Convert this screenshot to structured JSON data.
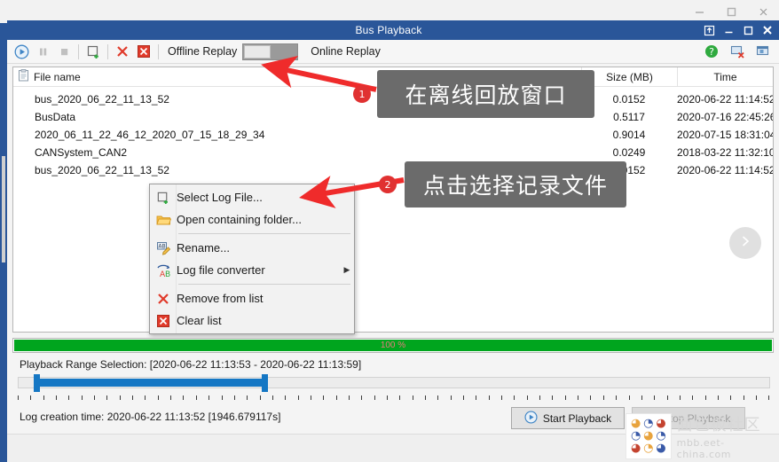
{
  "outer_window": {
    "minimize_label": "─",
    "maximize_label": "□",
    "close_label": "✕"
  },
  "window": {
    "title": "Bus Playback",
    "buttons": {
      "pin": "pin-icon",
      "minimize": "─",
      "maximize": "□",
      "close": "✕"
    }
  },
  "toolbar": {
    "play": "play-icon",
    "pause": "pause-icon",
    "stop": "stop-icon",
    "add_file": "add-file-icon",
    "remove": "remove-icon",
    "clear": "clear-icon",
    "offline_label": "Offline Replay",
    "online_label": "Online Replay",
    "toggle_state": "offline",
    "help": "help-icon",
    "detach": "detach-icon",
    "dock": "dock-icon"
  },
  "file_list": {
    "columns": [
      "File name",
      "Size (MB)",
      "Time"
    ],
    "header_icon": "clipboard-icon",
    "rows": [
      {
        "name": "bus_2020_06_22_11_13_52",
        "size": "0.0152",
        "time": "2020-06-22 11:14:52"
      },
      {
        "name": "BusData",
        "size": "0.5117",
        "time": "2020-07-16 22:45:26"
      },
      {
        "name": "2020_06_11_22_46_12_2020_07_15_18_29_34",
        "size": "0.9014",
        "time": "2020-07-15 18:31:04"
      },
      {
        "name": "CANSystem_CAN2",
        "size": "0.0249",
        "time": "2018-03-22 11:32:10"
      },
      {
        "name": "bus_2020_06_22_11_13_52",
        "size": "0.0152",
        "time": "2020-06-22 11:14:52"
      }
    ],
    "next_arrow": "chevron-right-icon"
  },
  "context_menu": {
    "items": [
      {
        "label": "Select Log File...",
        "icon": "add-file-icon",
        "submenu": false
      },
      {
        "label": "Open containing folder...",
        "icon": "folder-icon",
        "submenu": false
      },
      {
        "label": "Rename...",
        "icon": "rename-icon",
        "submenu": false
      },
      {
        "label": "Log file converter",
        "icon": "convert-icon",
        "submenu": true
      },
      {
        "label": "Remove from list",
        "icon": "remove-icon",
        "submenu": false
      },
      {
        "label": "Clear list",
        "icon": "clear-icon",
        "submenu": false
      }
    ],
    "submenu_arrow": "▶"
  },
  "progress": {
    "percent_label": "100 %",
    "value": 100,
    "color": "#00a51e"
  },
  "range": {
    "label": "Playback Range Selection: [2020-06-22 11:13:53 - 2020-06-22 11:13:59]",
    "start": "2020-06-22 11:13:53",
    "end": "2020-06-22 11:13:59",
    "selection_color": "#1577c4"
  },
  "footer": {
    "log_creation": "Log creation time: 2020-06-22 11:13:52 [1946.679117s]",
    "start_button": "Start Playback",
    "stop_button": "Stop Playback",
    "start_icon": "play-icon",
    "stop_icon": "stop-icon"
  },
  "annotations": [
    {
      "number": "1",
      "text": "在离线回放窗口"
    },
    {
      "number": "2",
      "text": "点击选择记录文件"
    }
  ],
  "watermark": {
    "cn": "面包板社区",
    "en": "mbb.eet-china.com"
  }
}
